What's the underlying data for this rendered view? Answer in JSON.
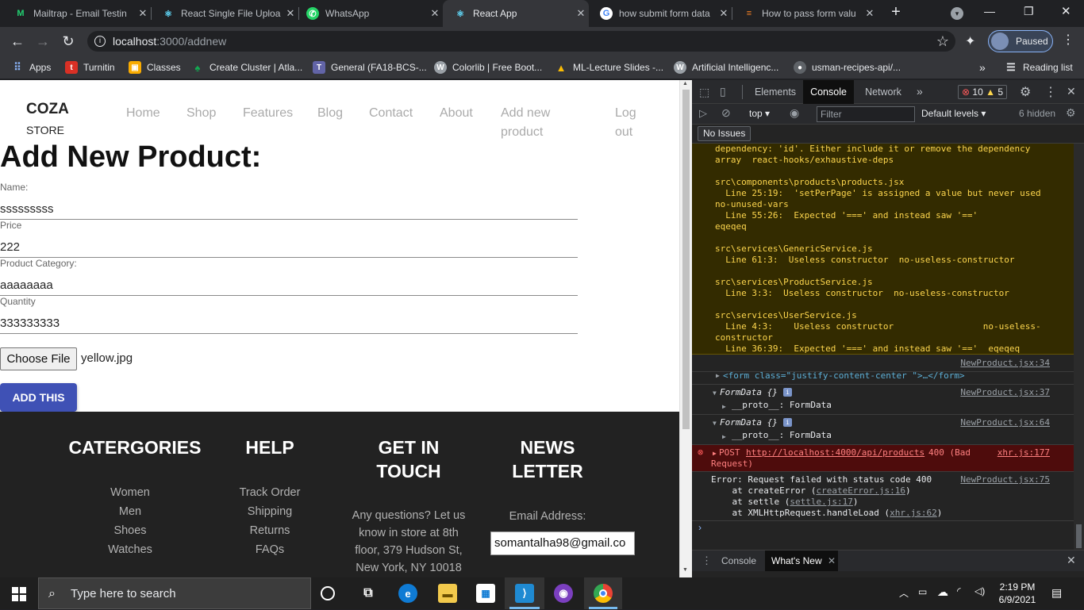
{
  "browser": {
    "tabs": [
      {
        "title": "Mailtrap - Email Testin",
        "icon": "mailtrap-icon",
        "color": "#22d172",
        "glyph": "M"
      },
      {
        "title": "React Single File Uploa",
        "icon": "react-icon",
        "color": "#61dafb",
        "glyph": "⚛"
      },
      {
        "title": "WhatsApp",
        "icon": "whatsapp-icon",
        "color": "#25d366",
        "glyph": "✆"
      },
      {
        "title": "React App",
        "icon": "react-icon",
        "color": "#61dafb",
        "glyph": "⚛"
      },
      {
        "title": "how submit form data",
        "icon": "google-icon",
        "color": "#ffffff",
        "glyph": "G"
      },
      {
        "title": "How to pass form valu",
        "icon": "stackoverflow-icon",
        "color": "#f48024",
        "glyph": "≡"
      }
    ],
    "url_host": "localhost",
    "url_path": ":3000/addnew",
    "profile_label": "Paused",
    "bookmarks": [
      {
        "label": "Apps",
        "icon": "apps-grid-icon",
        "color": "#8ab4f8"
      },
      {
        "label": "Turnitin",
        "icon": "turnitin-icon",
        "color": "#d93025"
      },
      {
        "label": "Classes",
        "icon": "classroom-icon",
        "color": "#f9ab00"
      },
      {
        "label": "Create Cluster | Atla...",
        "icon": "mongodb-leaf-icon",
        "color": "#13aa52"
      },
      {
        "label": "General (FA18-BCS-...",
        "icon": "teams-icon",
        "color": "#6264a7"
      },
      {
        "label": "Colorlib | Free Boot...",
        "icon": "wordpress-icon",
        "color": "#9aa0a6"
      },
      {
        "label": "ML-Lecture Slides -...",
        "icon": "drive-icon",
        "color": "#fbbc04"
      },
      {
        "label": "Artificial Intelligenc...",
        "icon": "wordpress-icon",
        "color": "#9aa0a6"
      },
      {
        "label": "usman-recipes-api/...",
        "icon": "github-icon",
        "color": "#5f6368"
      }
    ],
    "reading_list": "Reading list"
  },
  "page": {
    "brand_top": "COZA",
    "brand_bottom": "STORE",
    "nav": [
      "Home",
      "Shop",
      "Features",
      "Blog",
      "Contact",
      "About"
    ],
    "nav_add_1": "Add new",
    "nav_add_2": "product",
    "nav_logout_1": "Log",
    "nav_logout_2": "out",
    "title": "Add New Product:",
    "fields": [
      {
        "label": "Name:",
        "value": "sssssssss"
      },
      {
        "label": "Price",
        "value": "222"
      },
      {
        "label": "Product Category:",
        "value": "aaaaaaaa"
      },
      {
        "label": "Quantity",
        "value": "333333333"
      }
    ],
    "choose_file": "Choose File",
    "file_name": "yellow.jpg",
    "submit": "ADD THIS",
    "footer": {
      "categories_title": "CATERGORIES",
      "categories": [
        "Women",
        "Men",
        "Shoes",
        "Watches"
      ],
      "help_title": "HELP",
      "help": [
        "Track Order",
        "Shipping",
        "Returns",
        "FAQs"
      ],
      "touch_title_1": "GET IN",
      "touch_title_2": "TOUCH",
      "touch_lines": [
        "Any questions? Let us",
        "know in store at 8th",
        "floor, 379 Hudson St,",
        "New York, NY 10018"
      ],
      "news_title_1": "NEWS",
      "news_title_2": "LETTER",
      "email_label": "Email Address:",
      "email_value": "somantalha98@gmail.co"
    }
  },
  "devtools": {
    "tabs": [
      "Elements",
      "Console",
      "Network"
    ],
    "error_count": "10",
    "warning_count": "5",
    "context": "top",
    "filter_placeholder": "Filter",
    "levels": "Default levels",
    "hidden": "6 hidden",
    "no_issues": "No Issues",
    "warning_text": "dependency: 'id'. Either include it or remove the dependency\narray  react-hooks/exhaustive-deps\n\nsrc\\components\\products\\products.jsx\n  Line 25:19:  'setPerPage' is assigned a value but never used\nno-unused-vars\n  Line 55:26:  Expected '===' and instead saw '=='\neqeqeq\n\nsrc\\services\\GenericService.js\n  Line 61:3:  Useless constructor  no-useless-constructor\n\nsrc\\services\\ProductService.js\n  Line 3:3:  Useless constructor  no-useless-constructor\n\nsrc\\services\\UserService.js\n  Line 4:3:    Useless constructor                 no-useless-\nconstructor\n  Line 36:39:  Expected '===' and instead saw '=='  eqeqeq",
    "src1": "NewProduct.jsx:34",
    "form_line": "<form class=\"justify-content-center \">…</form>",
    "src2": "NewProduct.jsx:37",
    "formdata": "FormData {}",
    "proto": "__proto__: FormData",
    "src3": "NewProduct.jsx:64",
    "post_method": "POST",
    "post_url": "http://localhost:4000/api/products",
    "post_status": "400 (Bad",
    "post_status2": "Request)",
    "src4": "xhr.js:177",
    "error_line1": "Error: Request failed with status code 400",
    "error_line2a": "    at createError (",
    "error_line2b": "createError.js:16",
    "error_line3a": "    at settle (",
    "error_line3b": "settle.js:17",
    "error_line4a": "    at XMLHttpRequest.handleLoad (",
    "error_line4b": "xhr.js:62",
    "src5": "NewProduct.jsx:75",
    "drawer_tabs": [
      "Console",
      "What's New"
    ]
  },
  "taskbar": {
    "search_placeholder": "Type here to search",
    "time": "2:19 PM",
    "date": "6/9/2021"
  }
}
